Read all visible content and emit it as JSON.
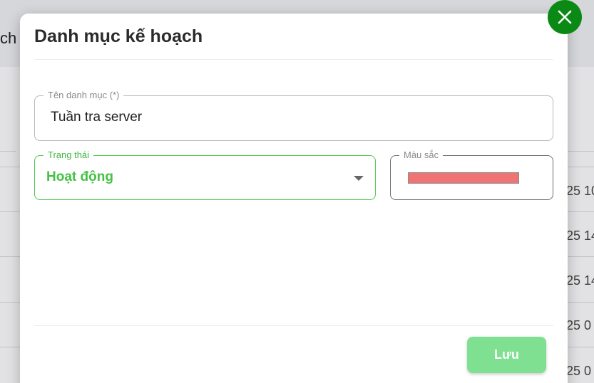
{
  "background": {
    "header_fragment": "ch",
    "row_fragments": [
      "25 10",
      "25 14",
      "25 14",
      "25 0",
      "25 0"
    ]
  },
  "modal": {
    "title": "Danh mục kế hoạch",
    "name_field": {
      "label": "Tên danh mục (*)",
      "value": "Tuần tra server"
    },
    "status_field": {
      "label": "Trạng thái",
      "value": "Hoạt động",
      "accent_color": "#45c145"
    },
    "color_field": {
      "label": "Màu sắc",
      "swatch_color": "#f07474"
    },
    "save_label": "Lưu",
    "save_color": "#7ee090",
    "close_icon": "close-icon",
    "close_color": "#0a8a14"
  }
}
